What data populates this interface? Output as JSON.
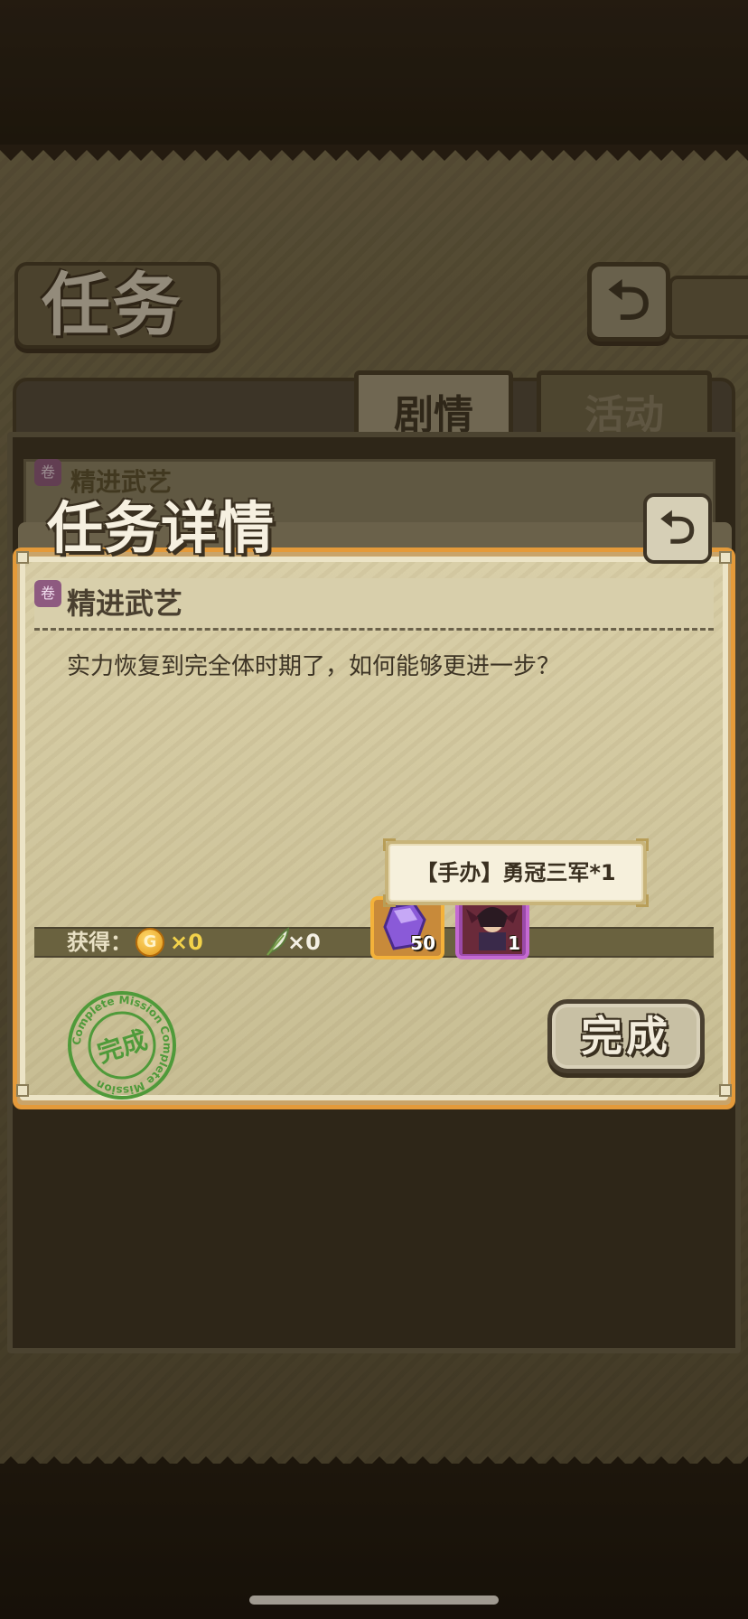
{
  "task_screen": {
    "title": "任务",
    "back_icon": "return-arrow-icon",
    "tabs": [
      {
        "label": "剧情",
        "selected": true
      },
      {
        "label": "活动",
        "selected": false
      }
    ],
    "list_item": {
      "title": "精进武艺"
    }
  },
  "dialog": {
    "title": "任务详情",
    "back_icon": "return-arrow-icon",
    "mission_title": "精进武艺",
    "mission_icon": "scroll-icon",
    "description": "实力恢复到完全体时期了，如何能够更进一步？",
    "reward_label": "获得：",
    "coin": {
      "symbol": "G",
      "count": "×0"
    },
    "feather": {
      "count": "×0"
    },
    "items": [
      {
        "name": "purple-gem",
        "count": "50"
      },
      {
        "name": "figure-card",
        "count": "1"
      }
    ],
    "tooltip": "【手办】勇冠三军*1",
    "stamp": {
      "ring_text": "Complete Mission Complete Mission",
      "center_text": "完成"
    },
    "complete_button": "完成"
  },
  "colors": {
    "accent_orange": "#e49a3a",
    "stamp_green": "#4f9a3a",
    "gem_purple": "#8a5ad8",
    "coin_gold": "#f2d24a"
  }
}
